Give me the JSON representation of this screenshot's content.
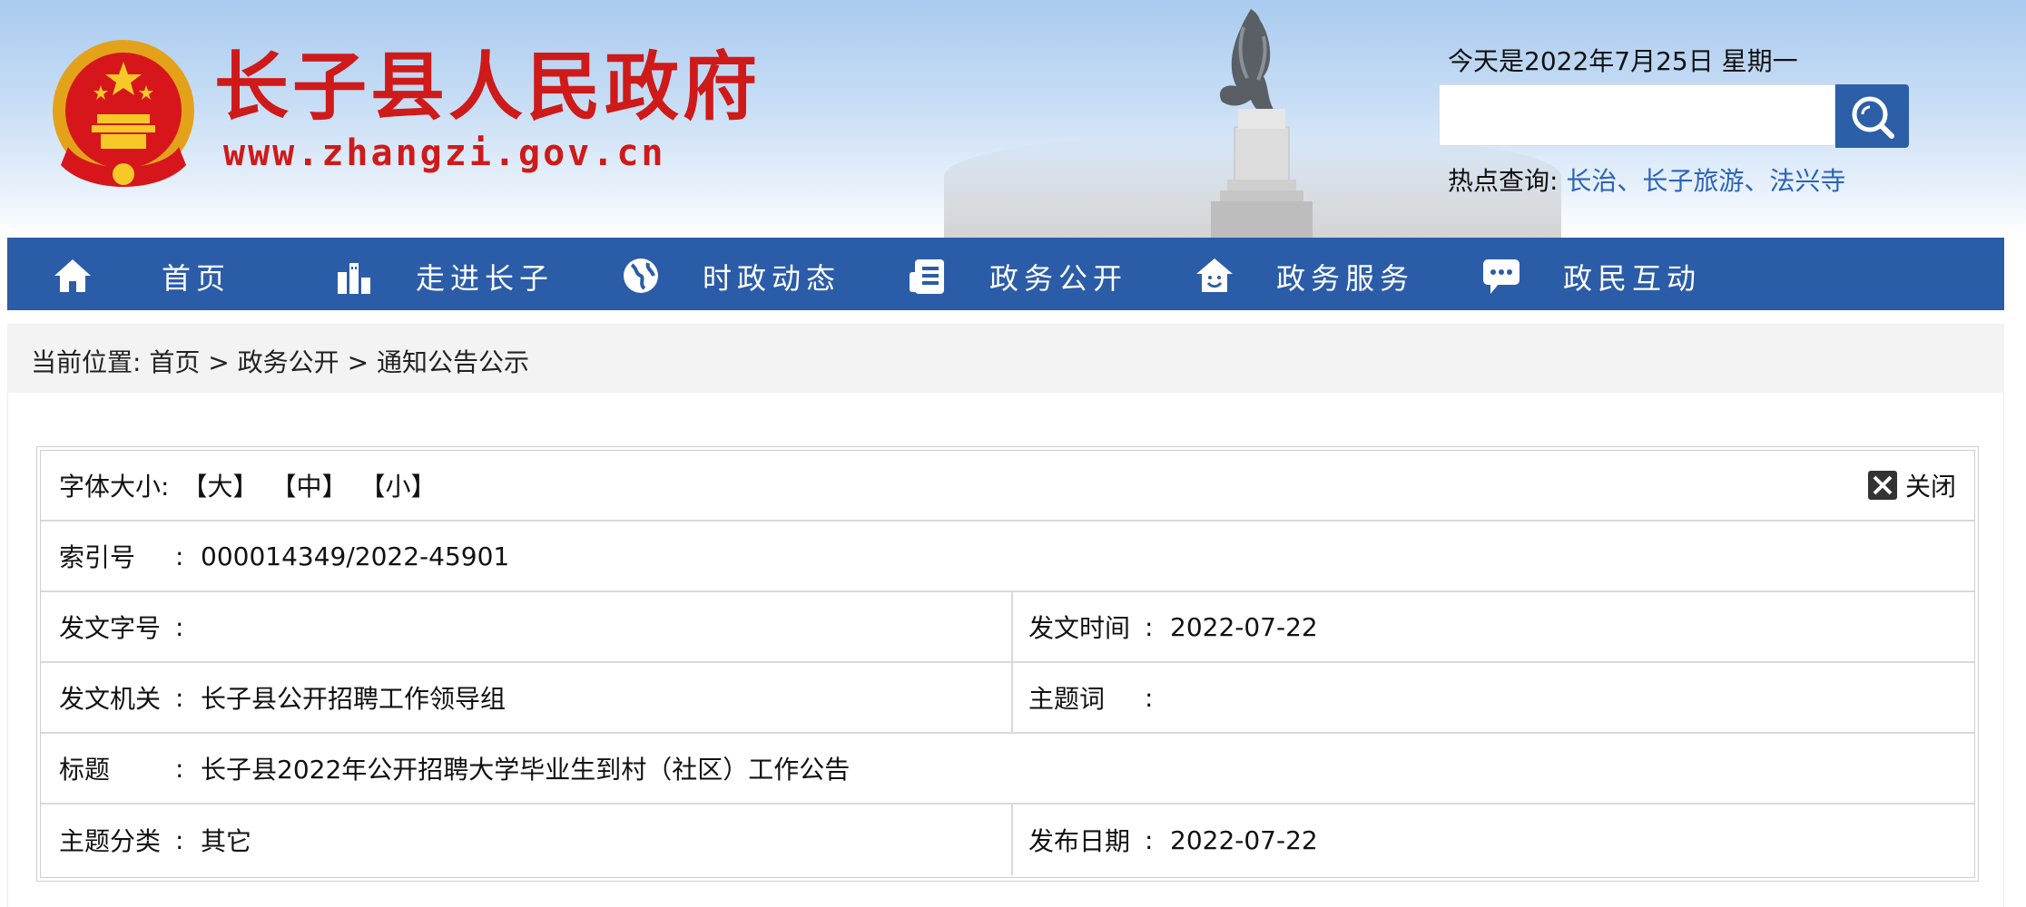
{
  "header": {
    "site_title": "长子县人民政府",
    "site_url": "www.zhangzi.gov.cn",
    "today": "今天是2022年7月25日 星期一",
    "search_placeholder": "",
    "hot_label": "热点查询:",
    "hot_links": [
      "长治",
      "长子旅游",
      "法兴寺"
    ],
    "hot_sep": "、"
  },
  "nav": [
    {
      "label": "首页",
      "icon": "home-icon"
    },
    {
      "label": "走进长子",
      "icon": "buildings-icon"
    },
    {
      "label": "时政动态",
      "icon": "globe-icon"
    },
    {
      "label": "政务公开",
      "icon": "document-icon"
    },
    {
      "label": "政务服务",
      "icon": "house-service-icon"
    },
    {
      "label": "政民互动",
      "icon": "chat-icon"
    }
  ],
  "breadcrumb": {
    "prefix": "当前位置:",
    "items": [
      "首页",
      "政务公开",
      "通知公告公示"
    ],
    "sep": ">"
  },
  "info": {
    "font_size_label": "字体大小:",
    "font_sizes": [
      "【大】",
      "【中】",
      "【小】"
    ],
    "close_label": "关闭",
    "index_label": "索引号",
    "index_value": "000014349/2022-45901",
    "doc_no_label": "发文字号",
    "doc_no_value": "",
    "issue_time_label": "发文时间",
    "issue_time_value": "2022-07-22",
    "issuer_label": "发文机关",
    "issuer_value": "长子县公开招聘工作领导组",
    "keywords_label": "主题词",
    "keywords_value": "",
    "title_label": "标题",
    "title_value": "长子县2022年公开招聘大学毕业生到村（社区）工作公告",
    "category_label": "主题分类",
    "category_value": "其它",
    "publish_date_label": "发布日期",
    "publish_date_value": "2022-07-22",
    "colon": ":"
  },
  "colors": {
    "brand_red": "#cf1a1a",
    "nav_blue": "#2b5ca8",
    "link_blue": "#2a63b7"
  }
}
